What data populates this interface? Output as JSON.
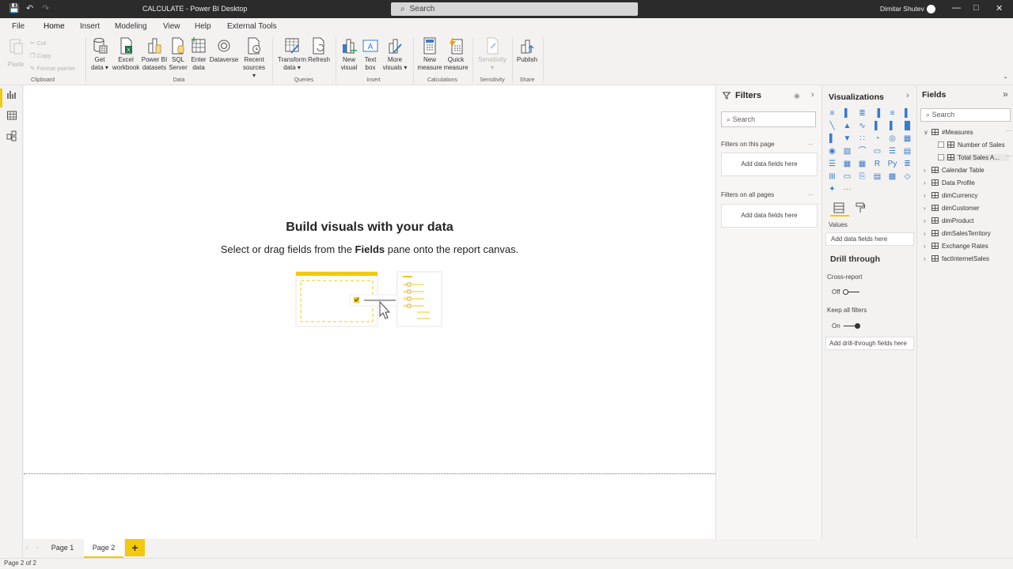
{
  "window": {
    "title": "CALCULATE - Power BI Desktop",
    "search_placeholder": "Search",
    "user_name": "Dimitar Shutev"
  },
  "menu": {
    "tabs": [
      "File",
      "Home",
      "Insert",
      "Modeling",
      "View",
      "Help",
      "External Tools"
    ],
    "active": "Home"
  },
  "ribbon": {
    "clipboard": {
      "paste": "Paste",
      "cut": "Cut",
      "copy": "Copy",
      "format_painter": "Format painter",
      "label": "Clipboard"
    },
    "data": {
      "label": "Data",
      "get_data": [
        "Get",
        "data ▾"
      ],
      "excel": [
        "Excel",
        "workbook"
      ],
      "pbi_datasets": [
        "Power BI",
        "datasets"
      ],
      "sql": [
        "SQL",
        "Server"
      ],
      "enter_data": [
        "Enter",
        "data"
      ],
      "dataverse": [
        "Dataverse",
        ""
      ],
      "recent": [
        "Recent",
        "sources ▾"
      ]
    },
    "queries": {
      "label": "Queries",
      "transform": [
        "Transform",
        "data ▾"
      ],
      "refresh": [
        "Refresh",
        ""
      ]
    },
    "insert": {
      "label": "Insert",
      "new_visual": [
        "New",
        "visual"
      ],
      "text_box": [
        "Text",
        "box"
      ],
      "more_visuals": [
        "More",
        "visuals ▾"
      ]
    },
    "calculations": {
      "label": "Calculations",
      "new_measure": [
        "New",
        "measure"
      ],
      "quick_measure": [
        "Quick",
        "measure"
      ]
    },
    "sensitivity": {
      "label": "Sensitivity",
      "button": [
        "Sensitivity",
        "▾"
      ]
    },
    "share": {
      "label": "Share",
      "publish": [
        "Publish",
        ""
      ]
    }
  },
  "canvas": {
    "title": "Build visuals with your data",
    "subtitle_pre": "Select or drag fields from the ",
    "subtitle_bold": "Fields",
    "subtitle_post": " pane onto the report canvas."
  },
  "pages": {
    "tabs": [
      "Page 1",
      "Page 2"
    ],
    "active": "Page 2",
    "add_label": "+"
  },
  "status": {
    "text": "Page 2 of 2"
  },
  "filters": {
    "title": "Filters",
    "search_placeholder": "Search",
    "on_this_page": "Filters on this page",
    "on_all_pages": "Filters on all pages",
    "drop_label": "Add data fields here",
    "more": "..."
  },
  "visualizations": {
    "title": "Visualizations",
    "values_label": "Values",
    "values_drop": "Add data fields here",
    "drill_title": "Drill through",
    "cross_report_label": "Cross-report",
    "cross_report_state": "Off",
    "keep_filters_label": "Keep all filters",
    "keep_filters_state": "On",
    "drill_drop": "Add drill-through fields here",
    "more": "···",
    "icons": [
      "stacked-bar-chart-icon",
      "stacked-column-chart-icon",
      "clustered-bar-chart-icon",
      "clustered-column-chart-icon",
      "100-stacked-bar-chart-icon",
      "100-stacked-column-chart-icon",
      "line-chart-icon",
      "area-chart-icon",
      "stacked-area-chart-icon",
      "line-column-chart-icon",
      "line-clustered-column-chart-icon",
      "ribbon-chart-icon",
      "waterfall-chart-icon",
      "funnel-chart-icon",
      "scatter-chart-icon",
      "pie-chart-icon",
      "donut-chart-icon",
      "treemap-icon",
      "map-icon",
      "filled-map-icon",
      "gauge-icon",
      "card-icon",
      "multi-row-card-icon",
      "kpi-icon",
      "slicer-icon",
      "table-icon",
      "matrix-icon",
      "r-visual-icon",
      "python-visual-icon",
      "key-influencers-icon",
      "decomposition-tree-icon",
      "qa-icon",
      "smart-narrative-icon",
      "paginated-report-icon",
      "power-apps-icon",
      "power-automate-icon",
      "azure-map-icon"
    ],
    "icon_glyphs": [
      "≡",
      "▌",
      "≣",
      "▐",
      "≡",
      "▌",
      "╲",
      "▲",
      "∿",
      "▌",
      "▌",
      "█",
      "▌",
      "▼",
      "∷",
      "◔",
      "◎",
      "▦",
      "◉",
      "▧",
      "⌒",
      "▭",
      "☰",
      "▤",
      "☰",
      "▦",
      "▦",
      "R",
      "Py",
      "≣",
      "⊞",
      "▭",
      "⎘",
      "▤",
      "▩",
      "◇",
      "✦"
    ]
  },
  "fields": {
    "title": "Fields",
    "search_placeholder": "Search",
    "tables": [
      {
        "name": "#Measures",
        "expanded": true,
        "children": [
          "Number of Sales",
          "Total Sales A..."
        ]
      },
      {
        "name": "Calendar Table"
      },
      {
        "name": "Data Profile"
      },
      {
        "name": "dimCurrency"
      },
      {
        "name": "dimCustomer"
      },
      {
        "name": "dimProduct"
      },
      {
        "name": "dimSalesTerritory"
      },
      {
        "name": "Exchange Rates"
      },
      {
        "name": "factInternetSales"
      }
    ],
    "more": "···"
  }
}
